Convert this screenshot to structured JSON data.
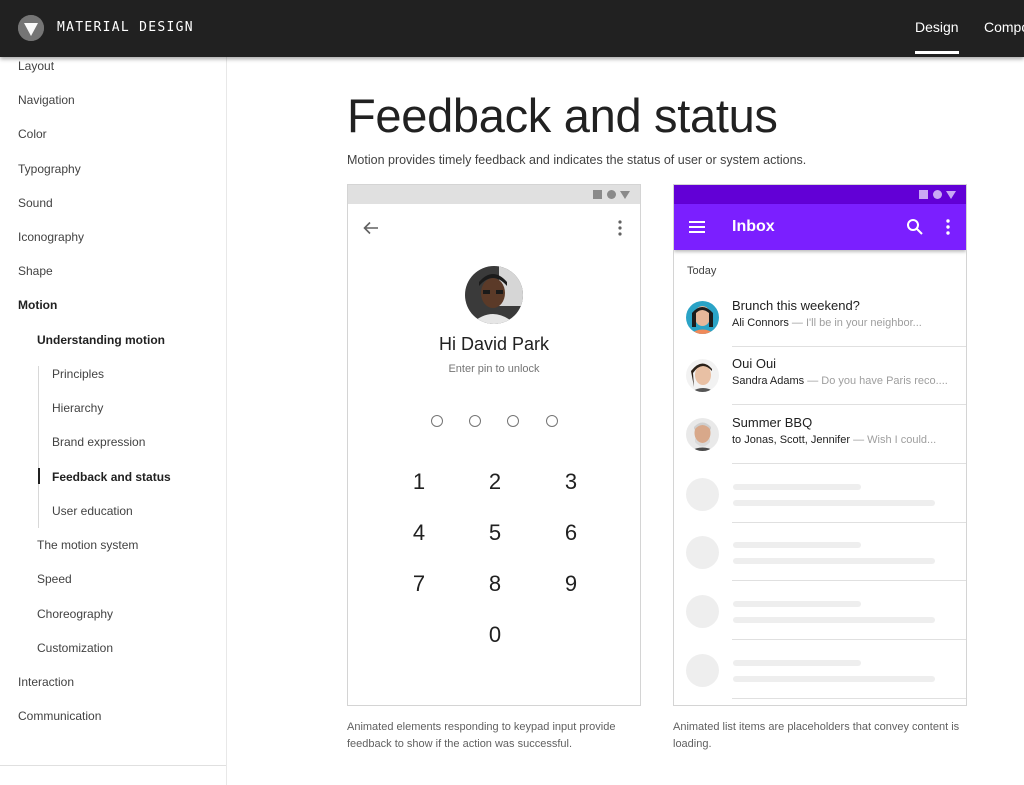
{
  "header": {
    "brand": "MATERIAL DESIGN",
    "tabs": [
      "Design",
      "Compo"
    ]
  },
  "sidebar": {
    "items": [
      {
        "label": "Layout"
      },
      {
        "label": "Navigation"
      },
      {
        "label": "Color"
      },
      {
        "label": "Typography"
      },
      {
        "label": "Sound"
      },
      {
        "label": "Iconography"
      },
      {
        "label": "Shape"
      },
      {
        "label": "Motion"
      },
      {
        "label": "Understanding motion"
      },
      {
        "label": "Principles"
      },
      {
        "label": "Hierarchy"
      },
      {
        "label": "Brand expression"
      },
      {
        "label": "Feedback and status"
      },
      {
        "label": "User education"
      },
      {
        "label": "The motion system"
      },
      {
        "label": "Speed"
      },
      {
        "label": "Choreography"
      },
      {
        "label": "Customization"
      },
      {
        "label": "Interaction"
      },
      {
        "label": "Communication"
      }
    ],
    "active": "Feedback and status"
  },
  "main": {
    "title": "Feedback and status",
    "subtitle": "Motion provides timely feedback and indicates the status of user or system actions."
  },
  "pin_demo": {
    "greeting": "Hi David Park",
    "hint": "Enter pin to unlock",
    "keys": [
      "1",
      "2",
      "3",
      "4",
      "5",
      "6",
      "7",
      "8",
      "9",
      "0"
    ],
    "caption": "Animated elements responding to keypad input provide feedback to show if the action was successful."
  },
  "inbox_demo": {
    "title": "Inbox",
    "section": "Today",
    "messages": [
      {
        "subject": "Brunch this weekend?",
        "from": "Ali Connors",
        "snippet": " — I'll be in your neighbor..."
      },
      {
        "subject": "Oui Oui",
        "from": "Sandra Adams",
        "snippet": " — Do you have Paris reco...."
      },
      {
        "subject": "Summer BBQ",
        "from": "to Jonas, Scott, Jennifer",
        "snippet": " — Wish I could..."
      }
    ],
    "caption": "Animated list items are placeholders that convey content is loading."
  },
  "colors": {
    "topbar": "#212121",
    "inbox_appbar": "#7b1fff",
    "inbox_status": "#6200d6"
  },
  "icons": [
    "logo-icon",
    "back-arrow-icon",
    "more-vert-icon",
    "menu-icon",
    "search-icon"
  ]
}
